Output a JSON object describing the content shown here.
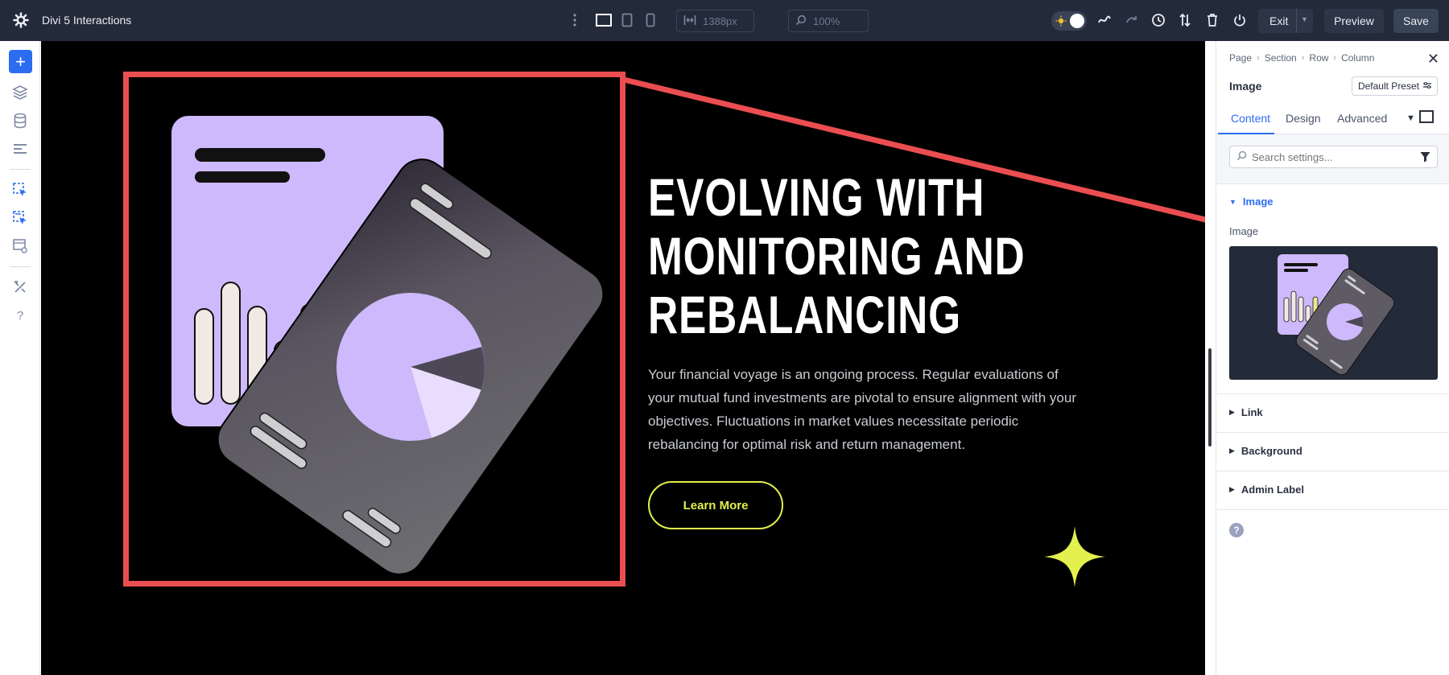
{
  "app": {
    "title": "Divi 5 Interactions"
  },
  "toolbar": {
    "width_value": "1388px",
    "zoom_value": "100%",
    "exit_label": "Exit",
    "preview_label": "Preview",
    "save_label": "Save"
  },
  "canvas": {
    "heading_lines": [
      "EVOLVING WITH",
      "MONITORING AND",
      "REBALANCING"
    ],
    "paragraph": "Your financial voyage is an ongoing process. Regular evaluations of your mutual fund investments are pivotal to ensure alignment with your objectives. Fluctuations in market values necessitate periodic rebalancing for optimal risk and return management.",
    "button_label": "Learn More"
  },
  "panel": {
    "breadcrumb": [
      "Page",
      "Section",
      "Row",
      "Column"
    ],
    "module_title": "Image",
    "preset_label": "Default Preset",
    "tabs": [
      "Content",
      "Design",
      "Advanced"
    ],
    "active_tab": "Content",
    "search_placeholder": "Search settings...",
    "sections": {
      "image": "Image",
      "image_field_label": "Image",
      "link": "Link",
      "background": "Background",
      "admin_label": "Admin Label"
    },
    "help_glyph": "?"
  },
  "colors": {
    "accent": "#2b6cf0",
    "annotation": "#ea4e50",
    "lime": "#e3f04d",
    "lavender": "#cdb9fb",
    "topbar": "#232a3a"
  }
}
